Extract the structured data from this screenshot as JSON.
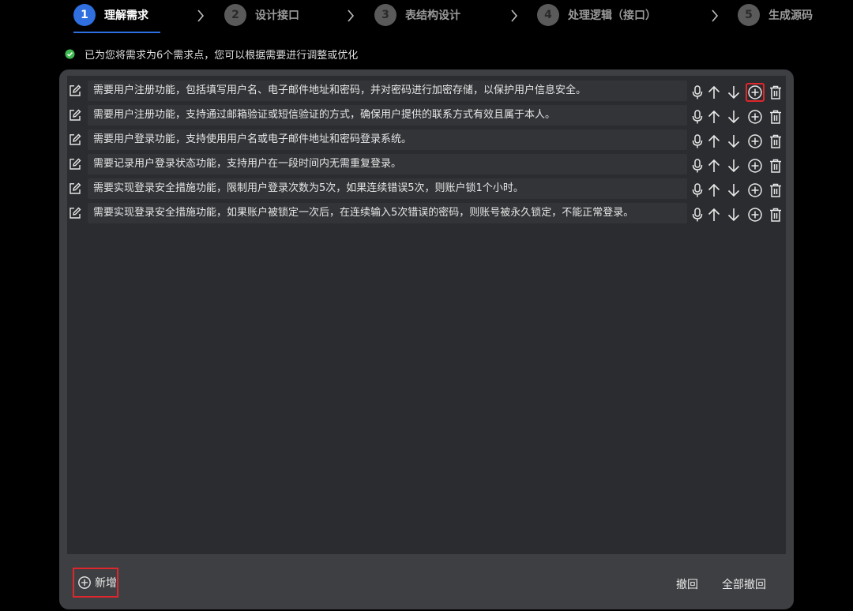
{
  "steps": [
    {
      "number": "1",
      "label": "理解需求",
      "active": true
    },
    {
      "number": "2",
      "label": "设计接口",
      "active": false
    },
    {
      "number": "3",
      "label": "表结构设计",
      "active": false
    },
    {
      "number": "4",
      "label": "处理逻辑（接口）",
      "active": false
    },
    {
      "number": "5",
      "label": "生成源码",
      "active": false
    }
  ],
  "info": {
    "text": "已为您将需求为6个需求点，您可以根据需要进行调整或优化",
    "icon": "check-circle-icon",
    "icon_color": "#3fb950"
  },
  "requirements": [
    "需要用户注册功能，包括填写用户名、电子邮件地址和密码，并对密码进行加密存储，以保护用户信息安全。",
    "需要用户注册功能，支持通过邮箱验证或短信验证的方式，确保用户提供的联系方式有效且属于本人。",
    "需要用户登录功能，支持使用用户名或电子邮件地址和密码登录系统。",
    "需要记录用户登录状态功能，支持用户在一段时间内无需重复登录。",
    "需要实现登录安全措施功能，限制用户登录次数为5次，如果连续错误5次，则账户锁1个小时。",
    "需要实现登录安全措施功能，如果账户被锁定一次后，在连续输入5次错误的密码，则账号被永久锁定，不能正常登录。"
  ],
  "row_actions": [
    "microphone-icon",
    "arrow-up-icon",
    "arrow-down-icon",
    "plus-circle-icon",
    "trash-icon"
  ],
  "footer": {
    "add_label": "新增",
    "undo_label": "撤回",
    "undo_all_label": "全部撤回"
  },
  "colors": {
    "accent": "#2f6fe0",
    "highlight": "#e0262d",
    "panel": "#3e3f42",
    "list_bg": "#2b2c2f"
  }
}
